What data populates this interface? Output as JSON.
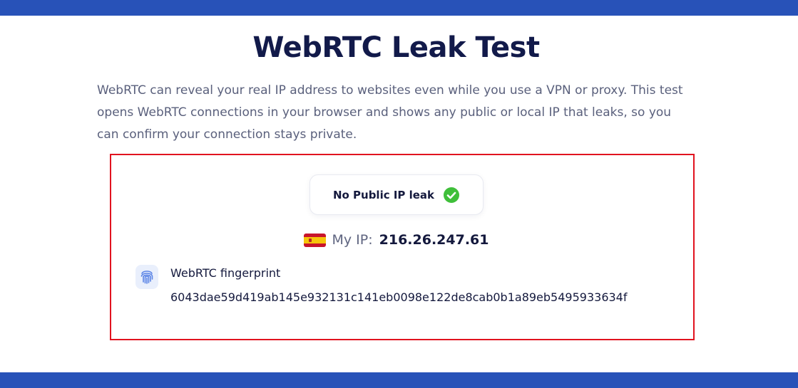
{
  "page": {
    "title": "WebRTC Leak Test",
    "description": "WebRTC can reveal your real IP address to websites even while you use a VPN or proxy. This test opens WebRTC connections in your browser and shows any public or local IP that leaks, so you can confirm your connection stays private."
  },
  "result": {
    "status": {
      "text": "No Public IP leak",
      "icon": "check-circle-icon",
      "color": "#3fbf3a"
    },
    "my_ip": {
      "flag_icon": "spain-flag-icon",
      "label": "My IP:",
      "value": "216.26.247.61"
    },
    "fingerprint": {
      "icon": "fingerprint-icon",
      "label": "WebRTC fingerprint",
      "value": "6043dae59d419ab145e932131c141eb0098e122de8cab0b1a89eb5495933634f"
    },
    "highlight_color": "#e1131f"
  },
  "colors": {
    "brand_bar": "#2852b8",
    "title": "#121a4a"
  }
}
